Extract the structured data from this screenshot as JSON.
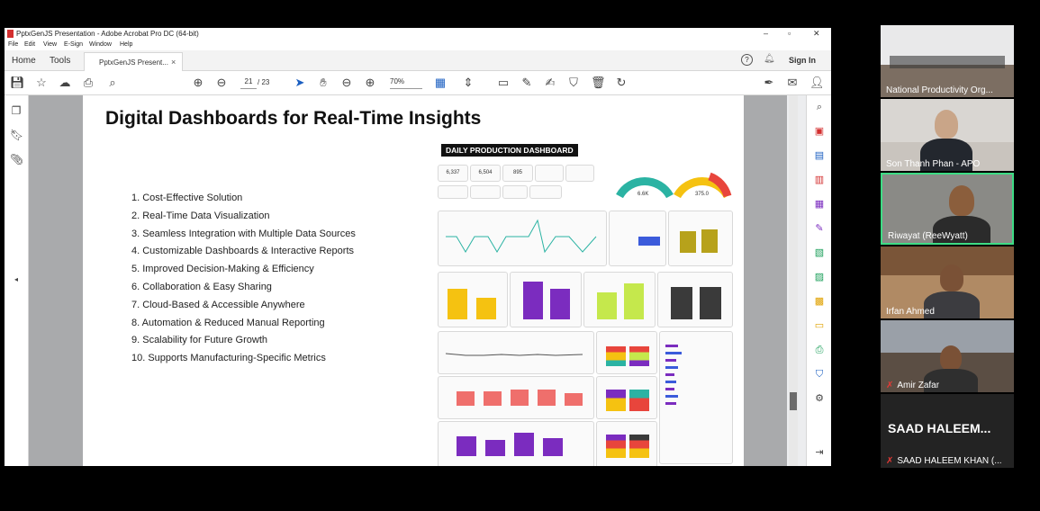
{
  "window": {
    "title": "PptxGenJS Presentation - Adobe Acrobat Pro DC (64-bit)",
    "controls": [
      "–",
      "▫",
      "✕"
    ]
  },
  "menu": [
    "File",
    "Edit",
    "View",
    "E-Sign",
    "Window",
    "Help"
  ],
  "tabs": {
    "home": "Home",
    "tools": "Tools",
    "document": "PptxGenJS Present...",
    "close": "×",
    "help": "?",
    "sign_in": "Sign In"
  },
  "toolbar": {
    "page_current": "21",
    "page_total": "/ 23",
    "zoom": "70%"
  },
  "slide": {
    "title": "Digital Dashboards for Real-Time Insights",
    "bullets": [
      "1. Cost-Effective Solution",
      "2. Real-Time Data Visualization",
      "3. Seamless Integration with Multiple Data Sources",
      "4. Customizable Dashboards & Interactive Reports",
      "5. Improved Decision-Making & Efficiency",
      "6. Collaboration & Easy Sharing",
      "7. Cloud-Based & Accessible Anywhere",
      "8. Automation & Reduced Manual Reporting",
      "9. Scalability for Future Growth",
      "10. Supports Manufacturing-Specific Metrics"
    ],
    "dashboard": {
      "title": "DAILY PRODUCTION DASHBOARD",
      "kpis": [
        "6,337",
        "6,504",
        "895"
      ],
      "gauge_values": [
        "6.6K",
        "375.0"
      ],
      "colors": {
        "teal": "#2bb3a3",
        "yellow": "#f5c211",
        "purple": "#7b2cbf",
        "lime": "#c5e84c",
        "dark": "#3a3a3a",
        "salmon": "#ef6f6c",
        "olive": "#b7a21b",
        "blue": "#3b5bdb"
      }
    }
  },
  "participants": [
    {
      "name": "National Productivity Org..."
    },
    {
      "name": "Son Thanh Phan - APO"
    },
    {
      "name": "Riwayat (ReeWyatt)"
    },
    {
      "name": "Irfan Ahmed"
    },
    {
      "name": "Amir Zafar",
      "muted": true
    },
    {
      "name": "SAAD HALEEM KHAN (...",
      "muted": true,
      "big_label": "SAAD  HALEEM..."
    }
  ]
}
